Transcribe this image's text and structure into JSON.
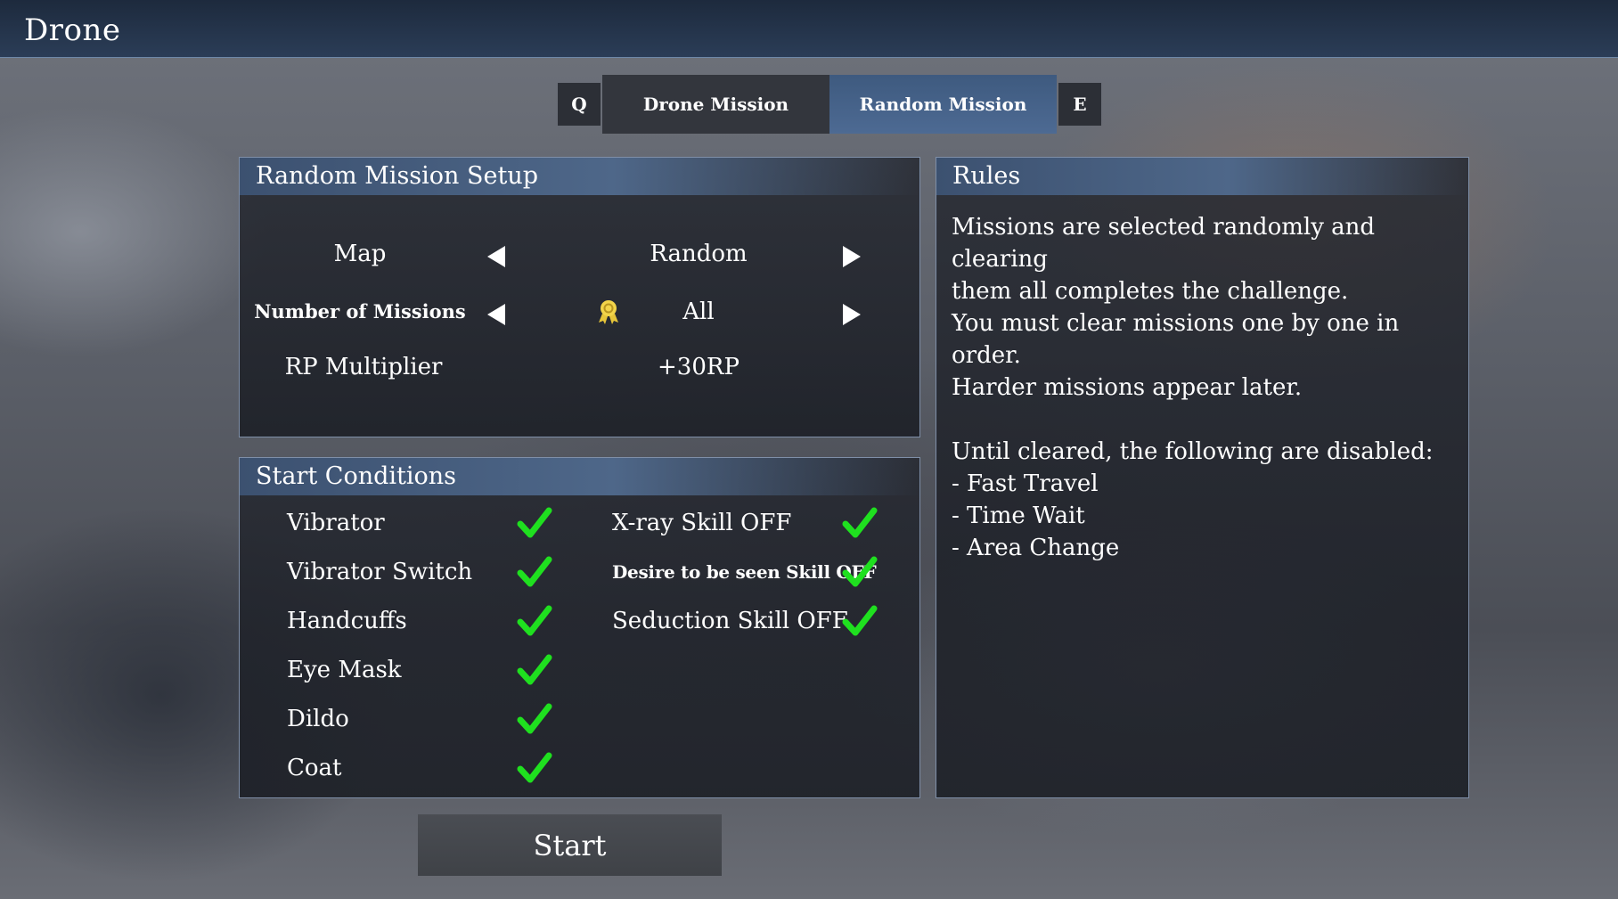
{
  "window": {
    "title": "Drone"
  },
  "tabs": {
    "prev_key": "Q",
    "next_key": "E",
    "items": [
      {
        "label": "Drone Mission",
        "active": false
      },
      {
        "label": "Random Mission",
        "active": true
      }
    ]
  },
  "setup": {
    "title": "Random Mission Setup",
    "map_label": "Map",
    "map_value": "Random",
    "missions_label": "Number of Missions",
    "missions_value": "All",
    "missions_icon": "medal-icon",
    "rp_label": "RP Multiplier",
    "rp_value": "+30RP"
  },
  "conditions": {
    "title": "Start Conditions",
    "left": [
      "Vibrator",
      "Vibrator Switch",
      "Handcuffs",
      "Eye Mask",
      "Dildo",
      "Coat"
    ],
    "right": [
      "X-ray Skill OFF",
      "Desire to be seen Skill OFF",
      "Seduction Skill OFF"
    ],
    "check_color": "#1fe01f"
  },
  "rules": {
    "title": "Rules",
    "lines": [
      "Missions are selected randomly and clearing",
      "them all completes the challenge.",
      "You must clear missions one by one in order.",
      "Harder missions appear later.",
      "",
      "Until cleared, the following are disabled:",
      "- Fast Travel",
      "- Time Wait",
      "- Area Change"
    ]
  },
  "start_label": "Start"
}
